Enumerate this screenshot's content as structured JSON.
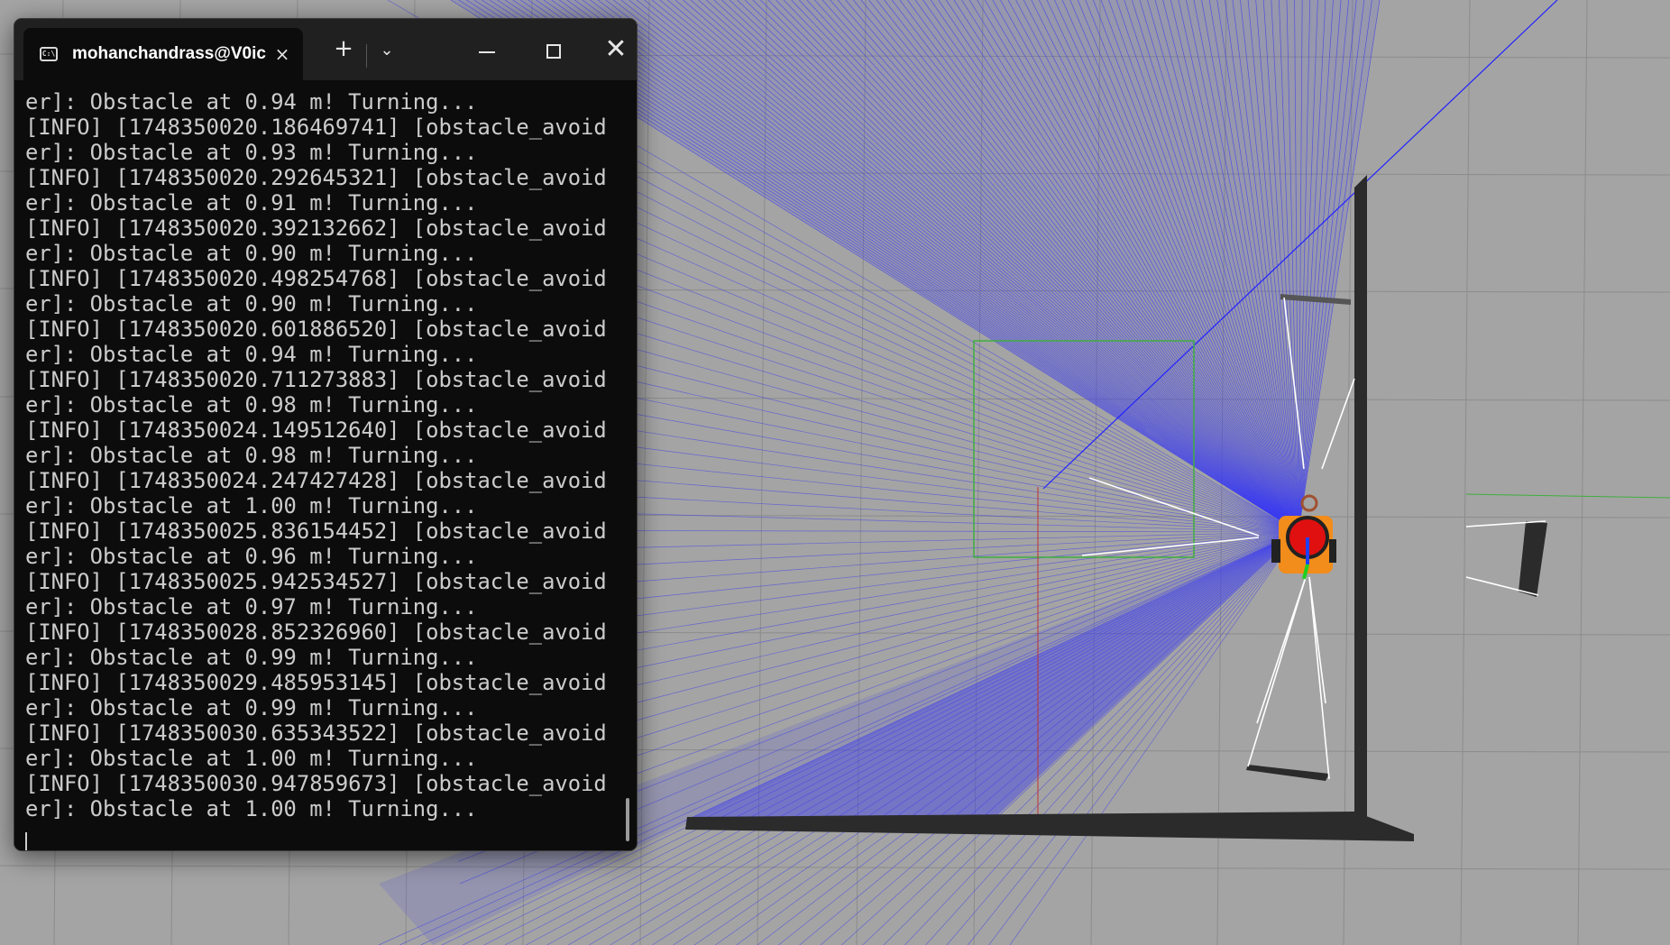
{
  "terminal": {
    "tab_title": "mohanchandrass@V0ic",
    "tab_icon": "C:\\",
    "new_tab_glyph": "+",
    "dropdown_glyph": "⌄",
    "close_glyph": "×",
    "window_close_glyph": "✕",
    "lines": [
      "er]: Obstacle at 0.94 m! Turning...",
      "[INFO] [1748350020.186469741] [obstacle_avoid",
      "er]: Obstacle at 0.93 m! Turning...",
      "[INFO] [1748350020.292645321] [obstacle_avoid",
      "er]: Obstacle at 0.91 m! Turning...",
      "[INFO] [1748350020.392132662] [obstacle_avoid",
      "er]: Obstacle at 0.90 m! Turning...",
      "[INFO] [1748350020.498254768] [obstacle_avoid",
      "er]: Obstacle at 0.90 m! Turning...",
      "[INFO] [1748350020.601886520] [obstacle_avoid",
      "er]: Obstacle at 0.94 m! Turning...",
      "[INFO] [1748350020.711273883] [obstacle_avoid",
      "er]: Obstacle at 0.98 m! Turning...",
      "[INFO] [1748350024.149512640] [obstacle_avoid",
      "er]: Obstacle at 0.98 m! Turning...",
      "[INFO] [1748350024.247427428] [obstacle_avoid",
      "er]: Obstacle at 1.00 m! Turning...",
      "[INFO] [1748350025.836154452] [obstacle_avoid",
      "er]: Obstacle at 0.96 m! Turning...",
      "[INFO] [1748350025.942534527] [obstacle_avoid",
      "er]: Obstacle at 0.97 m! Turning...",
      "[INFO] [1748350028.852326960] [obstacle_avoid",
      "er]: Obstacle at 0.99 m! Turning...",
      "[INFO] [1748350029.485953145] [obstacle_avoid",
      "er]: Obstacle at 0.99 m! Turning...",
      "[INFO] [1748350030.635343522] [obstacle_avoid",
      "er]: Obstacle at 1.00 m! Turning...",
      "[INFO] [1748350030.947859673] [obstacle_avoid",
      "er]: Obstacle at 1.00 m! Turning..."
    ]
  },
  "scene": {
    "ground_color": "#a4a4a4",
    "grid_color": "#8c8c8c",
    "laser_color": "#3c3cf0",
    "wall_color": "#2b2b2b",
    "robot_body_color": "#f28c1a",
    "robot_top_color": "#e01010"
  }
}
